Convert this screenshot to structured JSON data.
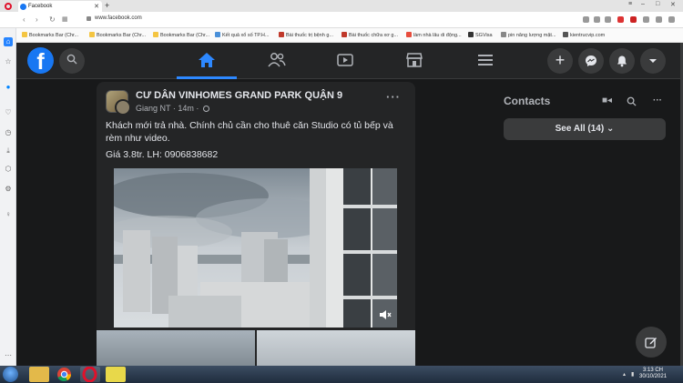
{
  "browser": {
    "tab_title": "Facebook",
    "url": "www.facebook.com",
    "bookmarks": [
      "Bookmarks Bar (Chr...",
      "Bookmarks Bar (Chr...",
      "Bookmarks Bar (Chr...",
      "Kết quả xổ số TP.H...",
      "Bài thuốc trị bệnh g...",
      "Bài thuốc chữa xơ g...",
      "làm nhà lâu di động...",
      "SGVisa",
      "pin năng lượng mặt...",
      "kientrucvip.com"
    ]
  },
  "post": {
    "group_name": "CƯ DÂN VINHOMES GRAND PARK QUẬN 9",
    "author": "Giang NT",
    "time": "14m",
    "text_line1": "Khách mới trả nhà. Chính chủ cần cho thuê căn Studio có tủ bếp và rèm như video.",
    "text_line2": "Giá 3.8tr. LH: 0906838682"
  },
  "contacts": {
    "title": "Contacts",
    "see_all": "See All (14)"
  },
  "taskbar": {
    "time": "3:13 CH",
    "date": "30/10/2021"
  }
}
